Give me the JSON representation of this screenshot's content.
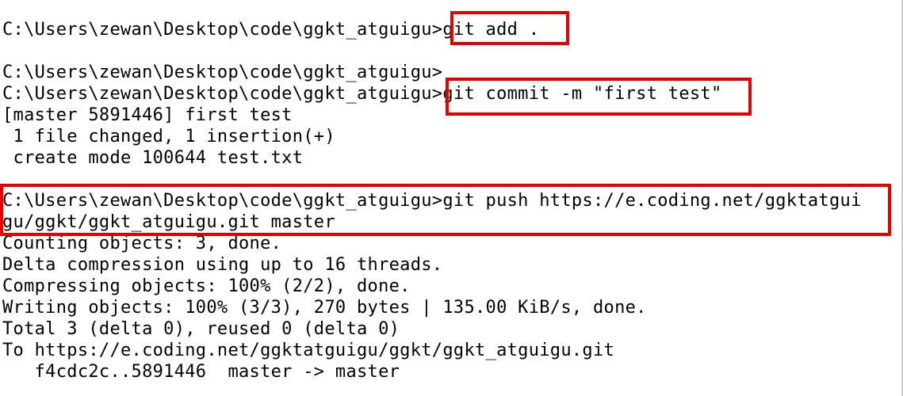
{
  "terminal": {
    "lines": [
      "C:\\Users\\zewan\\Desktop\\code\\ggkt_atguigu>git add .",
      "",
      "C:\\Users\\zewan\\Desktop\\code\\ggkt_atguigu>",
      "C:\\Users\\zewan\\Desktop\\code\\ggkt_atguigu>git commit -m \"first test\"",
      "[master 5891446] first test",
      " 1 file changed, 1 insertion(+)",
      " create mode 100644 test.txt",
      "",
      "C:\\Users\\zewan\\Desktop\\code\\ggkt_atguigu>git push https://e.coding.net/ggktatgui",
      "gu/ggkt/ggkt_atguigu.git master",
      "Counting objects: 3, done.",
      "Delta compression using up to 16 threads.",
      "Compressing objects: 100% (2/2), done.",
      "Writing objects: 100% (3/3), 270 bytes | 135.00 KiB/s, done.",
      "Total 3 (delta 0), reused 0 (delta 0)",
      "To https://e.coding.net/ggktatguigu/ggkt/ggkt_atguigu.git",
      "   f4cdc2c..5891446  master -> master"
    ],
    "highlight_color": "#e30000"
  }
}
